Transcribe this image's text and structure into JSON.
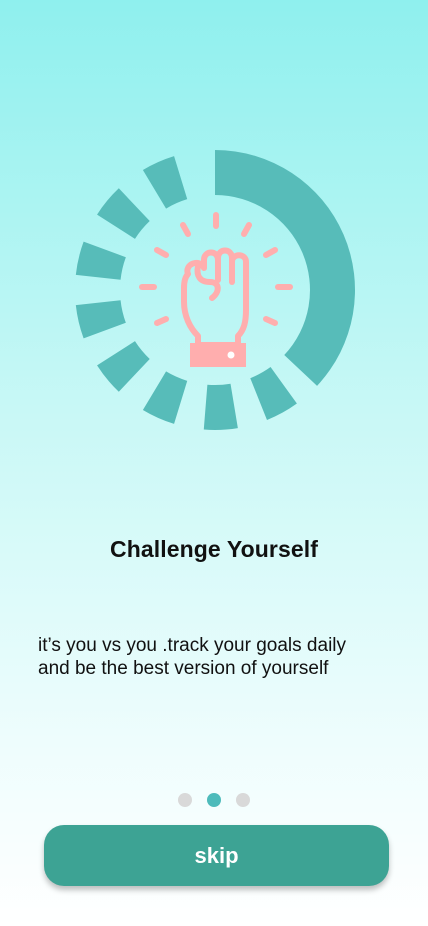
{
  "onboarding": {
    "title": "Challenge Yourself",
    "description_lines": [
      "it’s you vs you .track your goals daily",
      "and be the best version of yourself"
    ],
    "skip_label": "skip",
    "page_indicator": {
      "total": 3,
      "active_index": 1
    }
  },
  "illustration": {
    "name": "raised-fist-progress-ring",
    "ring_progress": 0.37
  },
  "colors": {
    "ring": "#57bcb9",
    "fist": "#ffaeae",
    "button": "#3da394",
    "dot_active": "#4dbbbb",
    "dot_inactive": "#d9d9d9"
  }
}
